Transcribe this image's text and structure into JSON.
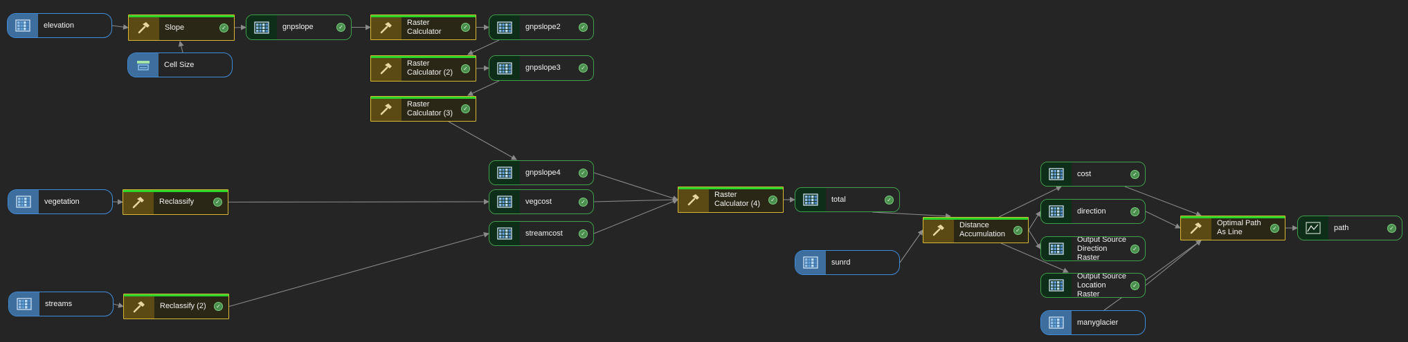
{
  "canvas": {
    "background": "#252525"
  },
  "colors": {
    "input_border": "#3f8fe0",
    "output_border": "#3fa24a",
    "tool_border": "#d9b834",
    "tool_status_bar": "#2bd62b",
    "link": "#8a8a8a"
  },
  "icons": {
    "raster": "raster-dataset-icon",
    "tool": "hammer-tool-icon",
    "variable": "cell-size-variable-icon",
    "valid": "check-circle-icon"
  },
  "nodes": [
    {
      "id": "elevation",
      "type": "input",
      "label": "elevation"
    },
    {
      "id": "slope",
      "type": "tool",
      "label": "Slope"
    },
    {
      "id": "gnpslope",
      "type": "output",
      "label": "gnpslope"
    },
    {
      "id": "rc1",
      "type": "tool",
      "label": "Raster Calculator"
    },
    {
      "id": "gnpslope2",
      "type": "output",
      "label": "gnpslope2"
    },
    {
      "id": "cellsize",
      "type": "input",
      "label": "Cell Size"
    },
    {
      "id": "rc2",
      "type": "tool",
      "label": "Raster Calculator (2)"
    },
    {
      "id": "gnpslope3",
      "type": "output",
      "label": "gnpslope3"
    },
    {
      "id": "rc3",
      "type": "tool",
      "label": "Raster Calculator (3)"
    },
    {
      "id": "gnpslope4",
      "type": "output",
      "label": "gnpslope4"
    },
    {
      "id": "vegetation",
      "type": "input",
      "label": "vegetation"
    },
    {
      "id": "reclassify",
      "type": "tool",
      "label": "Reclassify"
    },
    {
      "id": "vegcost",
      "type": "output",
      "label": "vegcost"
    },
    {
      "id": "streamcost",
      "type": "output",
      "label": "streamcost"
    },
    {
      "id": "streams",
      "type": "input",
      "label": "streams"
    },
    {
      "id": "reclassify2",
      "type": "tool",
      "label": "Reclassify (2)"
    },
    {
      "id": "rc4",
      "type": "tool",
      "label": "Raster Calculator (4)"
    },
    {
      "id": "total",
      "type": "output",
      "label": "total"
    },
    {
      "id": "sunrd",
      "type": "input",
      "label": "sunrd"
    },
    {
      "id": "distacc",
      "type": "tool",
      "label": "Distance Accumulation"
    },
    {
      "id": "cost",
      "type": "output",
      "label": "cost"
    },
    {
      "id": "direction",
      "type": "output",
      "label": "direction"
    },
    {
      "id": "osdr",
      "type": "output",
      "label": "Output Source Direction Raster"
    },
    {
      "id": "oslr",
      "type": "output",
      "label": "Output Source Location Raster"
    },
    {
      "id": "manyglacier",
      "type": "input",
      "label": "manyglacier"
    },
    {
      "id": "optpath",
      "type": "tool",
      "label": "Optimal Path As Line"
    },
    {
      "id": "path",
      "type": "output",
      "label": "path"
    }
  ],
  "links": [
    [
      "elevation",
      "slope"
    ],
    [
      "cellsize",
      "slope"
    ],
    [
      "slope",
      "gnpslope"
    ],
    [
      "gnpslope",
      "rc1"
    ],
    [
      "rc1",
      "gnpslope2"
    ],
    [
      "gnpslope2",
      "rc2"
    ],
    [
      "rc2",
      "gnpslope3"
    ],
    [
      "gnpslope3",
      "rc3"
    ],
    [
      "rc3",
      "gnpslope4"
    ],
    [
      "vegetation",
      "reclassify"
    ],
    [
      "reclassify",
      "vegcost"
    ],
    [
      "streams",
      "reclassify2"
    ],
    [
      "reclassify2",
      "streamcost"
    ],
    [
      "gnpslope4",
      "rc4"
    ],
    [
      "vegcost",
      "rc4"
    ],
    [
      "streamcost",
      "rc4"
    ],
    [
      "rc4",
      "total"
    ],
    [
      "total",
      "distacc"
    ],
    [
      "sunrd",
      "distacc"
    ],
    [
      "distacc",
      "cost"
    ],
    [
      "distacc",
      "direction"
    ],
    [
      "distacc",
      "osdr"
    ],
    [
      "distacc",
      "oslr"
    ],
    [
      "cost",
      "optpath"
    ],
    [
      "direction",
      "optpath"
    ],
    [
      "oslr",
      "optpath"
    ],
    [
      "manyglacier",
      "optpath"
    ],
    [
      "optpath",
      "path"
    ]
  ]
}
